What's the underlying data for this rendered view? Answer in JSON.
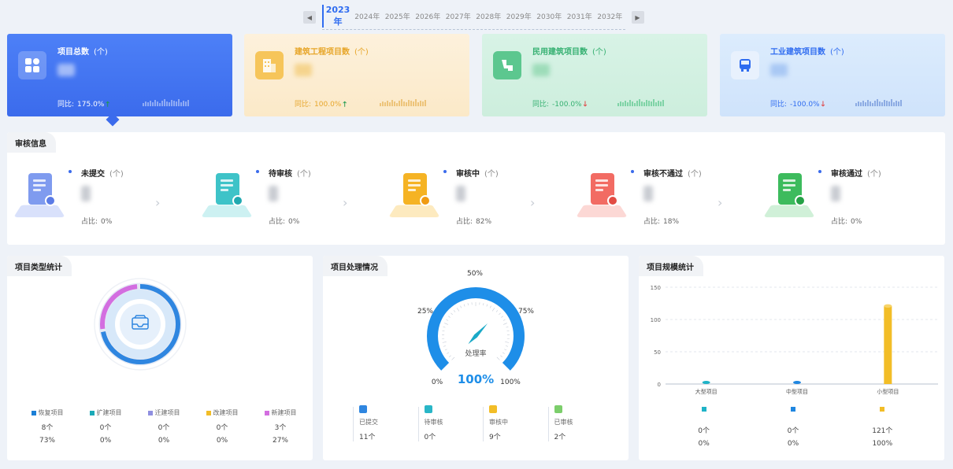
{
  "year_bar": {
    "prev_icon": "caret-left-icon",
    "next_icon": "caret-right-icon",
    "years": [
      "2023年",
      "2024年",
      "2025年",
      "2026年",
      "2027年",
      "2028年",
      "2029年",
      "2030年",
      "2031年",
      "2032年"
    ],
    "active_year": "2023年"
  },
  "top_cards": [
    {
      "title": "项目总数",
      "unit": "(个)",
      "yoy_label": "同比:",
      "yoy_value": "175.0%",
      "trend": "up",
      "icon": "grid-apps-icon",
      "accent": "#3b6bec"
    },
    {
      "title": "建筑工程项目数",
      "unit": "(个)",
      "yoy_label": "同比:",
      "yoy_value": "100.0%",
      "trend": "up",
      "icon": "building-icon",
      "accent": "#f6c55a"
    },
    {
      "title": "民用建筑项目数",
      "unit": "(个)",
      "yoy_label": "同比:",
      "yoy_value": "-100.0%",
      "trend": "down",
      "icon": "pipe-icon",
      "accent": "#5cc78f"
    },
    {
      "title": "工业建筑项目数",
      "unit": "(个)",
      "yoy_label": "同比:",
      "yoy_value": "-100.0%",
      "trend": "down",
      "icon": "bus-icon",
      "accent": "#2f6cf0"
    }
  ],
  "audit": {
    "title": "审核信息",
    "ratio_label": "占比:",
    "items": [
      {
        "title": "未提交",
        "unit": "(个)",
        "ratio": "0%",
        "color": "#7f9bef",
        "icon": "document-clock-icon"
      },
      {
        "title": "待审核",
        "unit": "(个)",
        "ratio": "0%",
        "color": "#3ec3c8",
        "icon": "document-clock-icon"
      },
      {
        "title": "审核中",
        "unit": "(个)",
        "ratio": "82%",
        "color": "#f5b324",
        "icon": "document-refresh-icon"
      },
      {
        "title": "审核不通过",
        "unit": "(个)",
        "ratio": "18%",
        "color": "#f26b63",
        "icon": "document-alert-icon"
      },
      {
        "title": "审核通过",
        "unit": "(个)",
        "ratio": "0%",
        "color": "#3dbb5d",
        "icon": "document-check-icon"
      }
    ]
  },
  "type_panel": {
    "title": "项目类型统计",
    "center_icon": "inbox-tray-icon",
    "legend": [
      {
        "label": "恢复项目",
        "count": "8个",
        "pct": "73%",
        "color": "#1b7fd6"
      },
      {
        "label": "扩建项目",
        "count": "0个",
        "pct": "0%",
        "color": "#1aa9b7"
      },
      {
        "label": "迁建项目",
        "count": "0个",
        "pct": "0%",
        "color": "#8f8fe0"
      },
      {
        "label": "改建项目",
        "count": "0个",
        "pct": "0%",
        "color": "#f2bd27"
      },
      {
        "label": "新建项目",
        "count": "3个",
        "pct": "27%",
        "color": "#d36ee0"
      }
    ]
  },
  "process_panel": {
    "title": "项目处理情况",
    "gauge_labels": [
      "0%",
      "25%",
      "50%",
      "75%",
      "100%"
    ],
    "gauge_caption": "处理率",
    "gauge_value": "100%",
    "gauge_fraction": 1.0,
    "statuses": [
      {
        "label": "已提交",
        "count": "11个",
        "color": "#2f86e0",
        "icon": "upload-doc-icon"
      },
      {
        "label": "待审核",
        "count": "0个",
        "color": "#29b6c7",
        "icon": "pending-doc-icon"
      },
      {
        "label": "审核中",
        "count": "9个",
        "color": "#f2bd27",
        "icon": "review-doc-icon"
      },
      {
        "label": "已审核",
        "count": "2个",
        "color": "#7cce6b",
        "icon": "approved-doc-icon"
      }
    ]
  },
  "scale_panel": {
    "title": "项目规模统计",
    "items": [
      {
        "count": "0个",
        "pct": "0%",
        "color": "#1fb3c7"
      },
      {
        "count": "0个",
        "pct": "0%",
        "color": "#1f86e0"
      },
      {
        "count": "121个",
        "pct": "100%",
        "color": "#f2bd27"
      }
    ]
  },
  "chart_data": {
    "type": "bar",
    "title": "项目规模统计",
    "categories": [
      "大型项目",
      "中型项目",
      "小型项目"
    ],
    "values": [
      0,
      0,
      121
    ],
    "ylim": [
      0,
      150
    ],
    "yticks": [
      "0",
      "50",
      "100",
      "150"
    ],
    "grid": true,
    "colors": [
      "#1fb3c7",
      "#1f86e0",
      "#f2bd27"
    ]
  }
}
